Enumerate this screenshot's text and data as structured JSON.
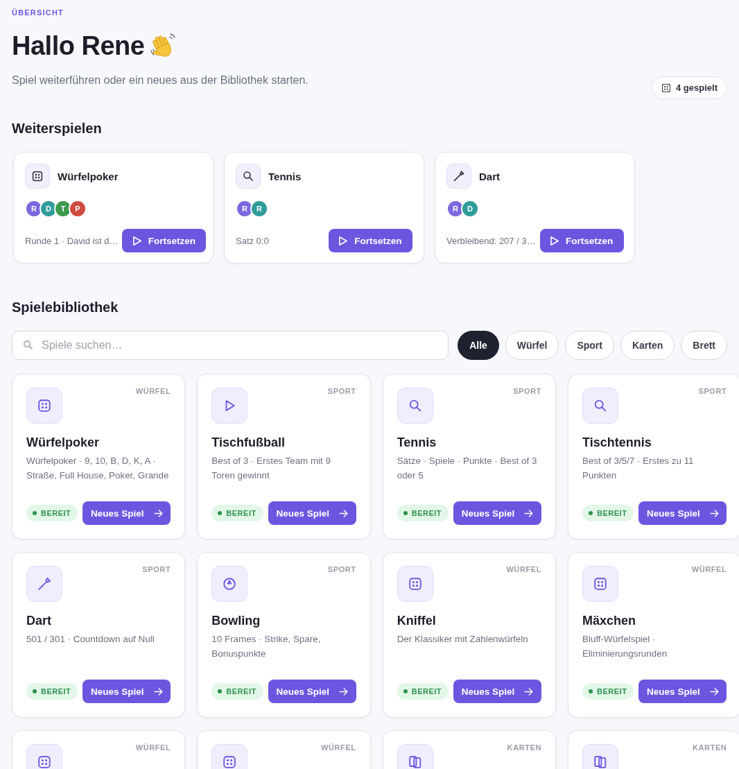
{
  "header": {
    "eyebrow": "ÜBERSICHT",
    "title": "Hallo Rene",
    "subtitle": "Spiel weiterführen oder ein neues aus der Bibliothek starten.",
    "played_count": "4 gespielt"
  },
  "continue": {
    "heading": "Weiterspielen",
    "games": [
      {
        "kind": "dice",
        "title": "Würfelpoker",
        "players": [
          {
            "initial": "R",
            "color": "#7b68e0"
          },
          {
            "initial": "D",
            "color": "#2e9c98"
          },
          {
            "initial": "T",
            "color": "#3d9a4f"
          },
          {
            "initial": "P",
            "color": "#cf4a3f"
          }
        ],
        "status": "Runde 1 · David ist d…",
        "button": "Fortsetzen"
      },
      {
        "kind": "magnifier",
        "title": "Tennis",
        "players": [
          {
            "initial": "R",
            "color": "#7b68e0"
          },
          {
            "initial": "R",
            "color": "#2e9c98"
          }
        ],
        "status": "Satz 0:0",
        "button": "Fortsetzen"
      },
      {
        "kind": "dart",
        "title": "Dart",
        "players": [
          {
            "initial": "R",
            "color": "#7b68e0"
          },
          {
            "initial": "D",
            "color": "#2e9c98"
          }
        ],
        "status": "Verbleibend: 207 / 3…",
        "button": "Fortsetzen"
      }
    ]
  },
  "library": {
    "heading": "Spielebibliothek",
    "search": {
      "placeholder": "Spiele suchen…"
    },
    "filters": [
      {
        "label": "Alle",
        "selected": true
      },
      {
        "label": "Würfel",
        "selected": false
      },
      {
        "label": "Sport",
        "selected": false
      },
      {
        "label": "Karten",
        "selected": false
      },
      {
        "label": "Brett",
        "selected": false
      }
    ],
    "games": [
      {
        "kind": "dice",
        "category": "WÜRFEL",
        "title": "Würfelpoker",
        "description": "Würfelpoker · 9, 10, B, D, K, A · Straße, Full House, Poker, Grande",
        "badge": "BEREIT",
        "button": "Neues Spiel"
      },
      {
        "kind": "play",
        "category": "SPORT",
        "title": "Tischfußball",
        "description": "Best of 3 · Erstes Team mit 9 Toren gewinnt",
        "badge": "BEREIT",
        "button": "Neues Spiel"
      },
      {
        "kind": "magnifier",
        "category": "SPORT",
        "title": "Tennis",
        "description": "Sätze · Spiele · Punkte · Best of 3 oder 5",
        "badge": "BEREIT",
        "button": "Neues Spiel"
      },
      {
        "kind": "magnifier",
        "category": "SPORT",
        "title": "Tischtennis",
        "description": "Best of 3/5/7 · Erstes zu 11 Punkten",
        "badge": "BEREIT",
        "button": "Neues Spiel"
      },
      {
        "kind": "dart",
        "category": "SPORT",
        "title": "Dart",
        "description": "501 / 301 · Countdown auf Null",
        "badge": "BEREIT",
        "button": "Neues Spiel"
      },
      {
        "kind": "ball",
        "category": "SPORT",
        "title": "Bowling",
        "description": "10 Frames · Strike, Spare, Bonuspunkte",
        "badge": "BEREIT",
        "button": "Neues Spiel"
      },
      {
        "kind": "dice",
        "category": "WÜRFEL",
        "title": "Kniffel",
        "description": "Der Klassiker mit Zahlenwürfeln",
        "badge": "BEREIT",
        "button": "Neues Spiel"
      },
      {
        "kind": "dice",
        "category": "WÜRFEL",
        "title": "Mäxchen",
        "description": "Bluff-Würfelspiel · Eliminierungsrunden",
        "badge": "BEREIT",
        "button": "Neues Spiel"
      },
      {
        "kind": "dice",
        "category": "WÜRFEL"
      },
      {
        "kind": "dice",
        "category": "WÜRFEL"
      },
      {
        "kind": "cards",
        "category": "KARTEN"
      },
      {
        "kind": "cards",
        "category": "KARTEN"
      }
    ]
  }
}
